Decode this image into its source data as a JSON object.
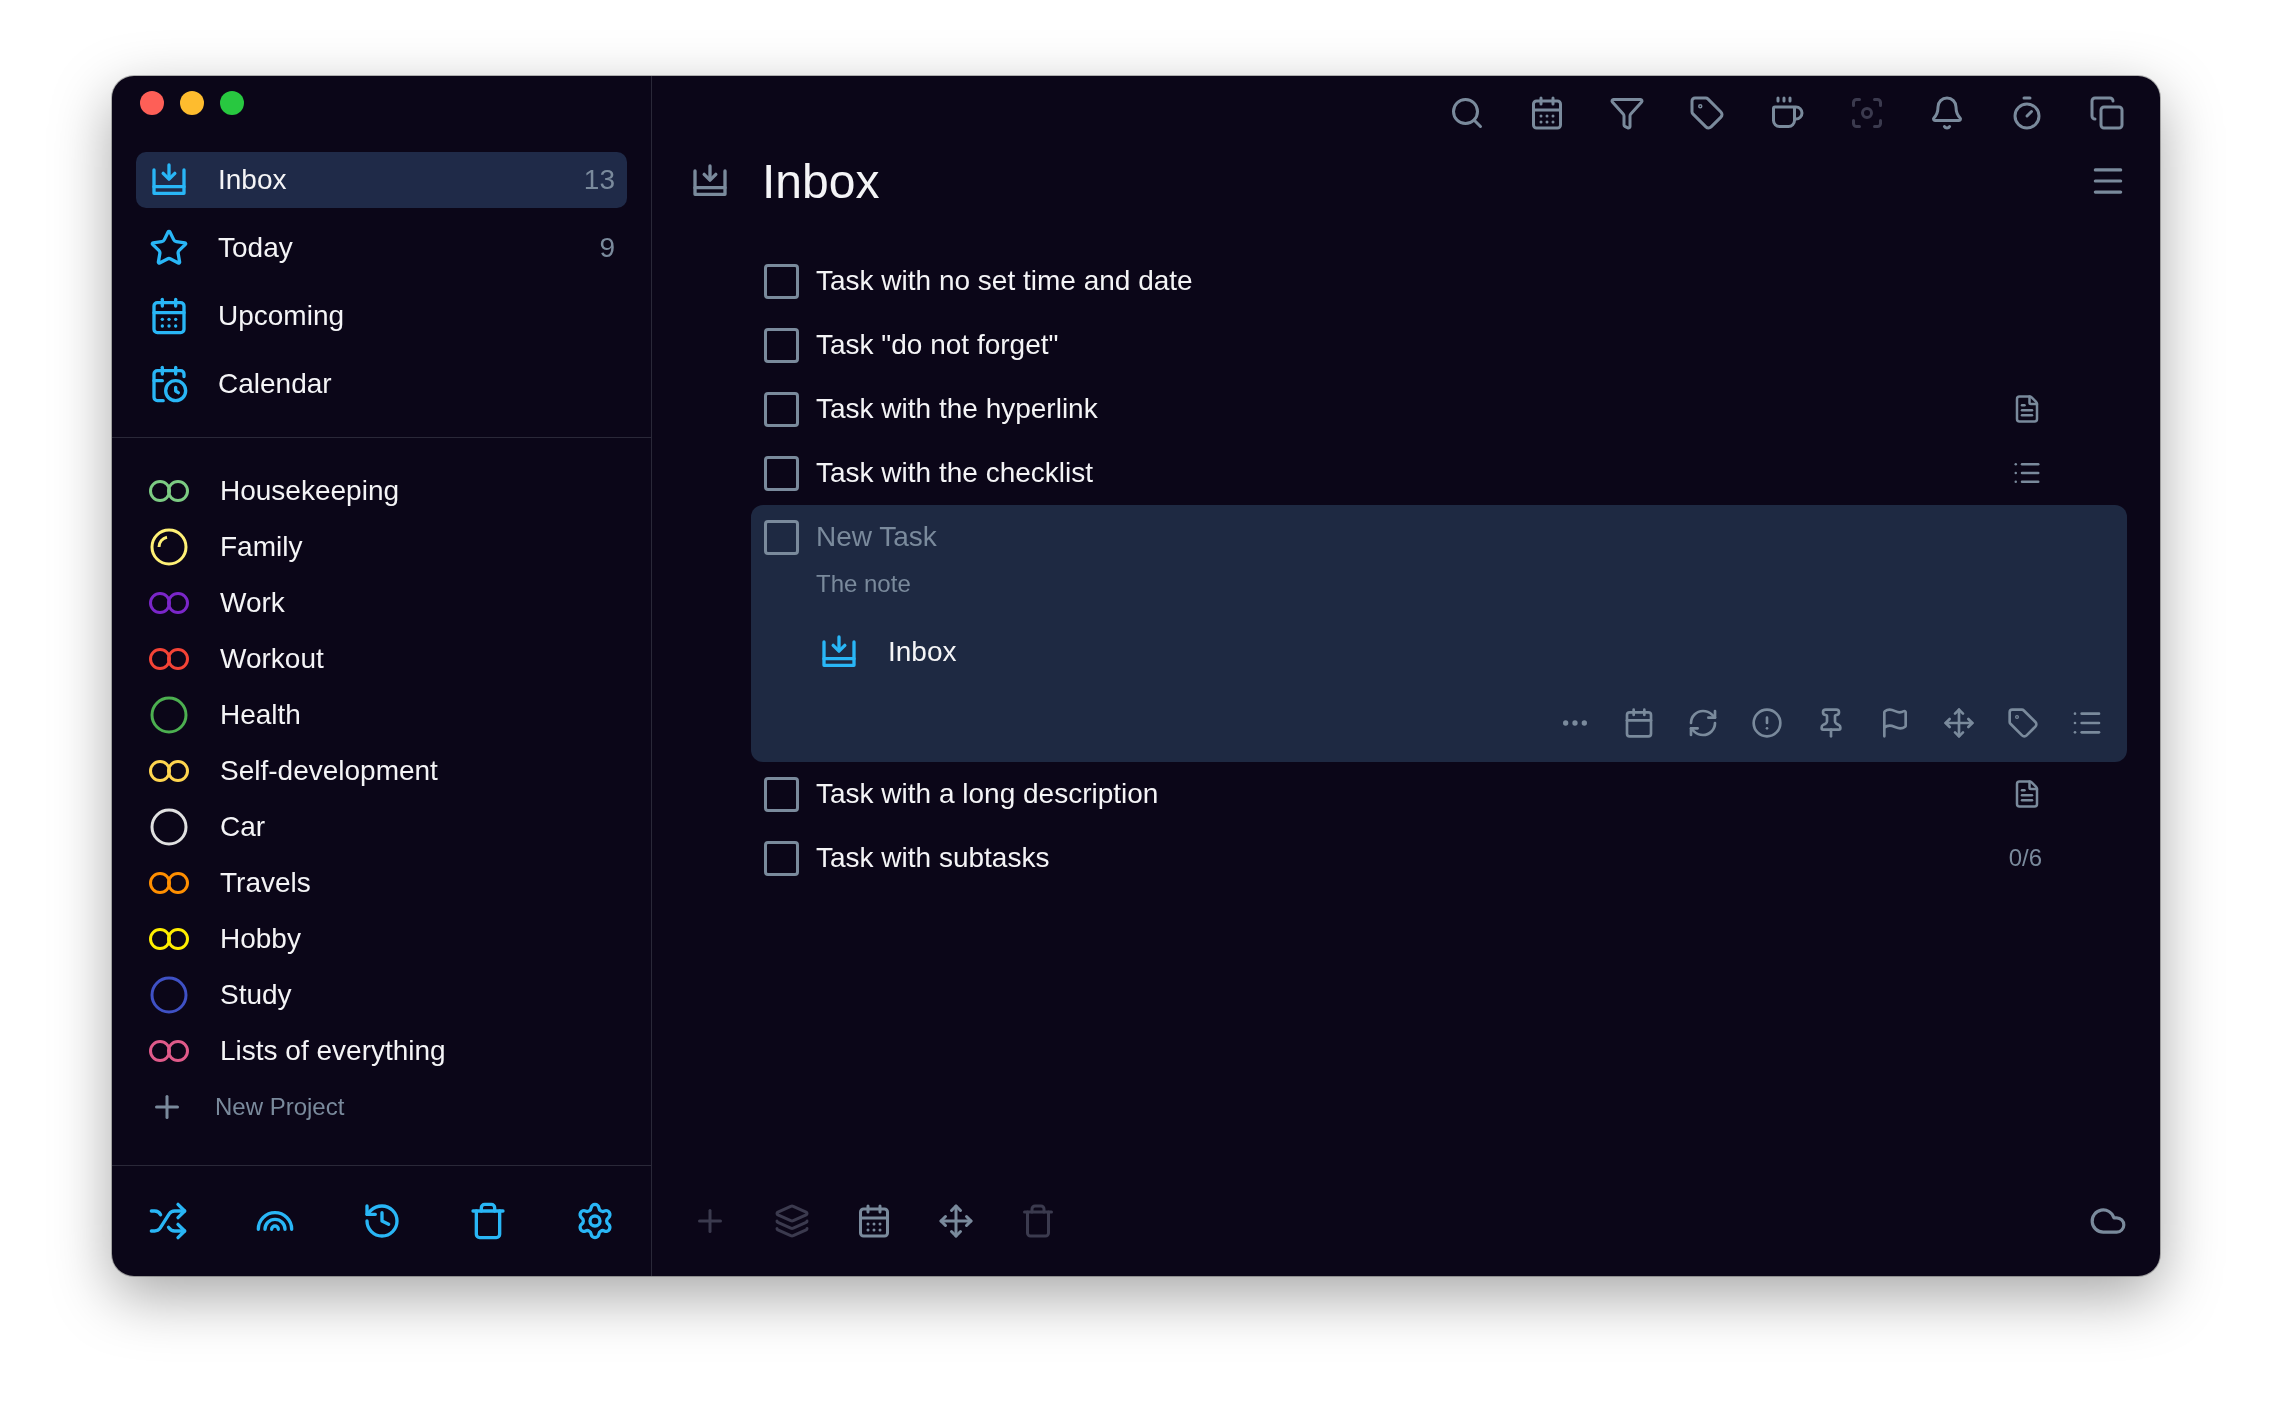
{
  "window": {
    "controls": [
      {
        "color": "#fe5f57"
      },
      {
        "color": "#febc2e"
      },
      {
        "color": "#28c840"
      }
    ]
  },
  "sidebar": {
    "nav": [
      {
        "kind": "inbox",
        "label": "Inbox",
        "count": "13",
        "selected": true
      },
      {
        "kind": "today",
        "label": "Today",
        "count": "9",
        "selected": false
      },
      {
        "kind": "upcoming",
        "label": "Upcoming",
        "selected": false
      },
      {
        "kind": "calendar",
        "label": "Calendar",
        "selected": false
      }
    ],
    "projects": [
      {
        "label": "Housekeeping",
        "kind": "double",
        "color": "#7ccb83"
      },
      {
        "label": "Family",
        "kind": "partial",
        "color": "#fff176"
      },
      {
        "label": "Work",
        "kind": "double",
        "color": "#7b26c9"
      },
      {
        "label": "Workout",
        "kind": "double",
        "color": "#f44336"
      },
      {
        "label": "Health",
        "kind": "ring",
        "color": "#4caf50"
      },
      {
        "label": "Self-development",
        "kind": "double",
        "color": "#ffd54f"
      },
      {
        "label": "Car",
        "kind": "ring",
        "color": "#e0e0e0"
      },
      {
        "label": "Travels",
        "kind": "double",
        "color": "#ff8f00"
      },
      {
        "label": "Hobby",
        "kind": "double",
        "color": "#ffee00"
      },
      {
        "label": "Study",
        "kind": "ring",
        "color": "#3f51c5"
      },
      {
        "label": "Lists of everything",
        "kind": "double",
        "color": "#e05a8a"
      }
    ],
    "new_project": "New Project",
    "bottom_bar": [
      {
        "kind": "shuffle"
      },
      {
        "kind": "rainbow"
      },
      {
        "kind": "history"
      },
      {
        "kind": "trash"
      },
      {
        "kind": "settings"
      }
    ]
  },
  "toolbar": [
    {
      "kind": "search",
      "disabled": false
    },
    {
      "kind": "calendar",
      "disabled": false
    },
    {
      "kind": "filter",
      "disabled": false
    },
    {
      "kind": "tag",
      "disabled": false
    },
    {
      "kind": "cup",
      "disabled": false
    },
    {
      "kind": "focus",
      "disabled": true
    },
    {
      "kind": "bell",
      "disabled": false
    },
    {
      "kind": "timer",
      "disabled": false
    },
    {
      "kind": "copy",
      "disabled": false
    }
  ],
  "header": {
    "title": "Inbox"
  },
  "tasks": [
    {
      "title": "Task with no set time and date",
      "checked": false,
      "expanded": false
    },
    {
      "title": "Task \"do not forget\"",
      "checked": false,
      "expanded": false
    },
    {
      "title": "Task with the hyperlink",
      "checked": false,
      "expanded": false,
      "accessory": {
        "kind": "note"
      }
    },
    {
      "title": "Task with the checklist",
      "checked": false,
      "expanded": false,
      "accessory": {
        "kind": "checklist"
      }
    },
    {
      "title_field": {
        "placeholder": "New Task"
      },
      "note_field": {
        "placeholder": "The note"
      },
      "project": "Inbox",
      "checked": false,
      "expanded": true,
      "actions": [
        {
          "kind": "more"
        },
        {
          "kind": "date"
        },
        {
          "kind": "repeat"
        },
        {
          "kind": "priority"
        },
        {
          "kind": "pin"
        },
        {
          "kind": "flag"
        },
        {
          "kind": "move"
        },
        {
          "kind": "tag"
        },
        {
          "kind": "checklist"
        }
      ]
    },
    {
      "title": "Task with a long description",
      "checked": false,
      "expanded": false,
      "accessory": {
        "kind": "note"
      }
    },
    {
      "title": "Task with subtasks",
      "checked": false,
      "expanded": false,
      "accessory": {
        "kind": "count",
        "text": "0/6"
      }
    }
  ],
  "bottom_bar": [
    {
      "kind": "add",
      "disabled": true
    },
    {
      "kind": "layers",
      "disabled": true
    },
    {
      "kind": "calendar",
      "disabled": false
    },
    {
      "kind": "move",
      "disabled": false
    },
    {
      "kind": "trash",
      "disabled": true
    }
  ],
  "sync": {
    "kind": "cloud"
  }
}
